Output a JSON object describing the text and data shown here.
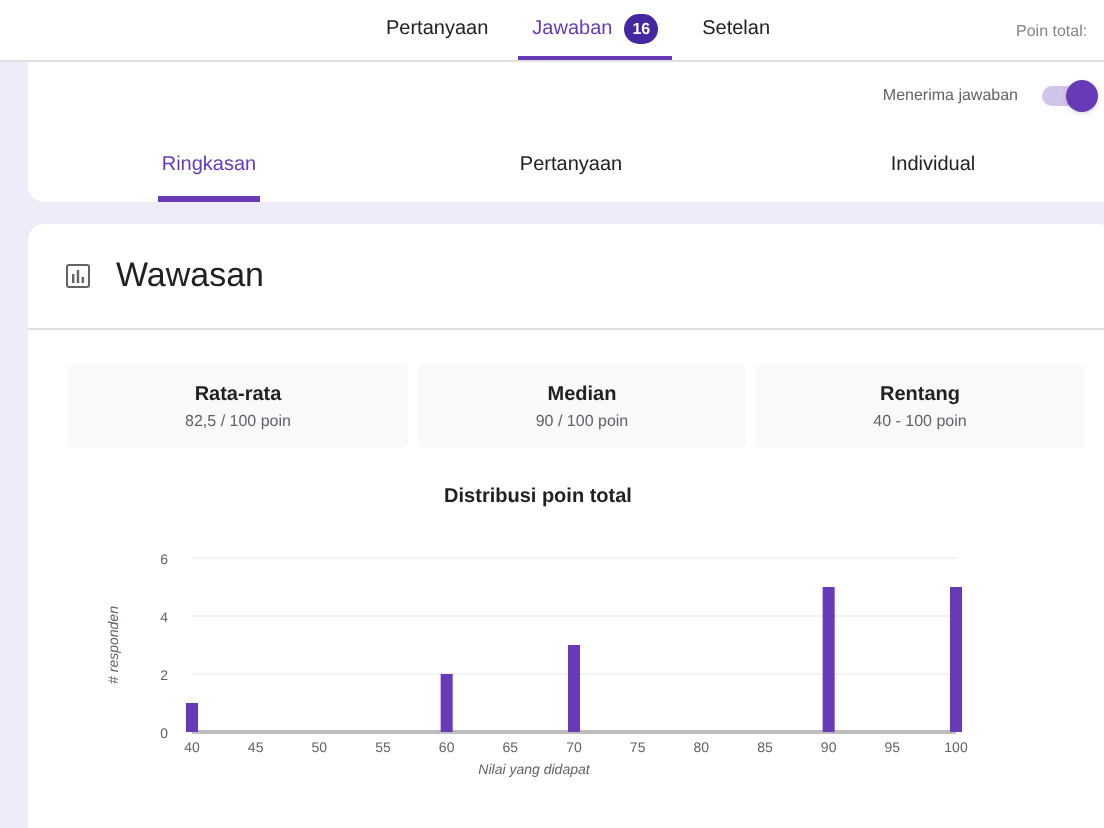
{
  "top_tabs": [
    {
      "label": "Pertanyaan",
      "selected": false
    },
    {
      "label": "Jawaban",
      "selected": true,
      "badge": "16"
    },
    {
      "label": "Setelan",
      "selected": false
    }
  ],
  "total_points": "Poin total:",
  "accepting": {
    "label": "Menerima jawaban",
    "on": true
  },
  "view_tabs": [
    {
      "label": "Ringkasan",
      "selected": true
    },
    {
      "label": "Pertanyaan",
      "selected": false
    },
    {
      "label": "Individual",
      "selected": false
    }
  ],
  "insights": {
    "title": "Wawasan",
    "stats": [
      {
        "label": "Rata-rata",
        "value": "82,5 / 100 poin"
      },
      {
        "label": "Median",
        "value": "90 / 100 poin"
      },
      {
        "label": "Rentang",
        "value": "40 - 100 poin"
      }
    ],
    "chart_data": {
      "type": "bar",
      "title": "Distribusi poin total",
      "xlabel": "Nilai yang didapat",
      "ylabel": "# responden",
      "x": [
        40,
        60,
        70,
        90,
        100
      ],
      "series": [
        {
          "color": "#673ab7",
          "values": [
            1,
            2,
            3,
            5,
            5
          ]
        }
      ],
      "xlim": [
        40,
        100
      ],
      "ylim": [
        0,
        6
      ],
      "xticks": [
        40,
        45,
        50,
        55,
        60,
        65,
        70,
        75,
        80,
        85,
        90,
        95,
        100
      ],
      "yticks": [
        0,
        2,
        4,
        6
      ]
    }
  }
}
